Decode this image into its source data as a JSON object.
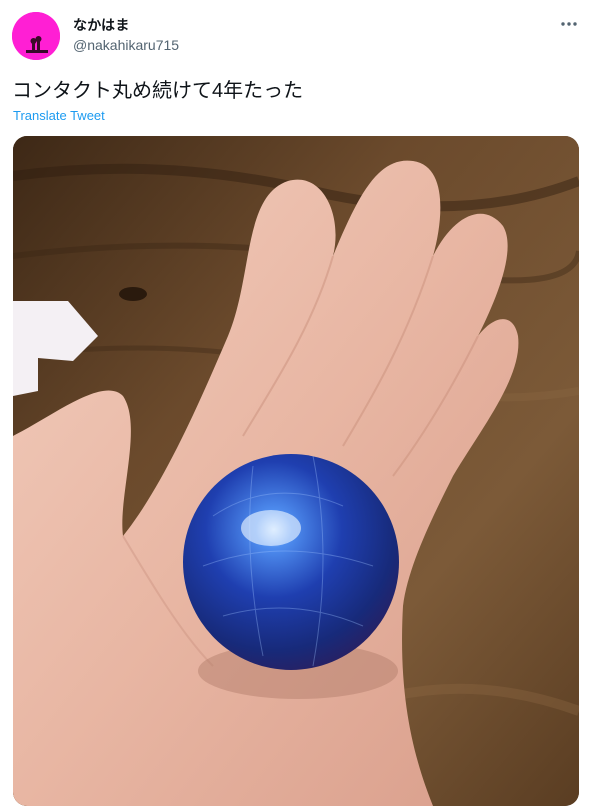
{
  "author": {
    "display_name": "なかはま",
    "handle": "@nakahikaru715",
    "avatar_color": "#ff1fd4"
  },
  "more_icon": "more-horizontal-icon",
  "tweet": {
    "text": "コンタクト丸め続けて4年たった",
    "translate_label": "Translate Tweet"
  },
  "media": {
    "subject": "photo of a hand holding a blue translucent ball of used contact lenses"
  },
  "colors": {
    "link": "#1d9bf0",
    "secondary_text": "#536471",
    "primary_text": "#0f1419"
  }
}
